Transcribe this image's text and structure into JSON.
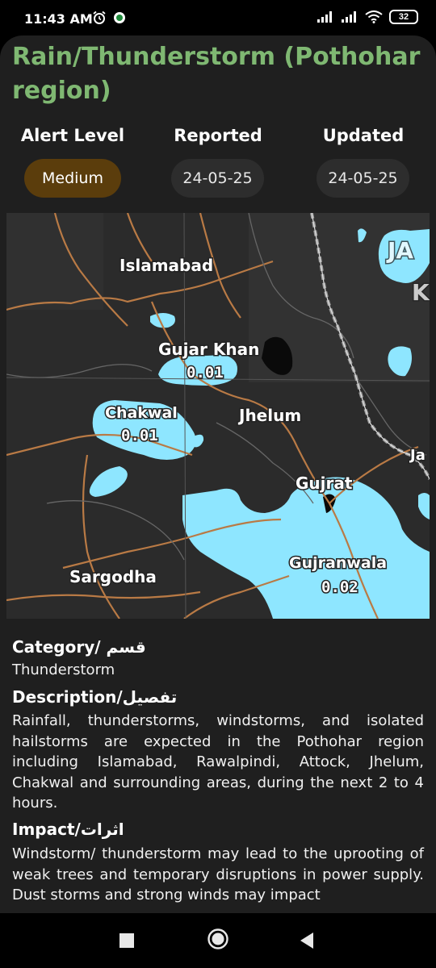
{
  "status_bar": {
    "time": "11:43 AM",
    "battery": "32",
    "icons": [
      "alarm-icon",
      "app-notification-icon",
      "signal-icon",
      "signal-icon",
      "wifi-icon",
      "battery-icon"
    ]
  },
  "alert": {
    "title": "Rain/Thunderstorm (Pothohar region)",
    "columns": [
      {
        "heading": "Alert Level",
        "value": "Medium"
      },
      {
        "heading": "Reported",
        "value": "24-05-25"
      },
      {
        "heading": "Updated",
        "value": "24-05-25"
      }
    ],
    "level_color": "#5b3d0c",
    "title_color": "#7fb872"
  },
  "map": {
    "cities": [
      "Islamabad",
      "Gujar Khan",
      "Chakwal",
      "Jhelum",
      "Gujrat",
      "Sargodha",
      "Gujranwala",
      "JA",
      "K",
      "Ja"
    ],
    "values": {
      "gujar_khan": "0.01",
      "chakwal": "0.01",
      "gujranwala": "0.02"
    },
    "rain_color": "#8ee6ff"
  },
  "details": {
    "category_heading": "Category/ قسم",
    "category_text": "Thunderstorm",
    "description_heading": "Description/تفصیل",
    "description_text": "Rainfall, thunderstorms, windstorms, and isolated hailstorms are expected in the Pothohar region including Islamabad, Rawalpindi, Attock, Jhelum, Chakwal and surrounding areas, during the next 2 to 4 hours.",
    "impact_heading": "Impact/اثرات",
    "impact_text": "Windstorm/ thunderstorm may lead to the uprooting of weak trees and temporary disruptions in power supply. Dust storms and strong winds may impact"
  },
  "nav": {
    "buttons": [
      "recent-apps-icon",
      "home-icon",
      "back-icon"
    ]
  }
}
